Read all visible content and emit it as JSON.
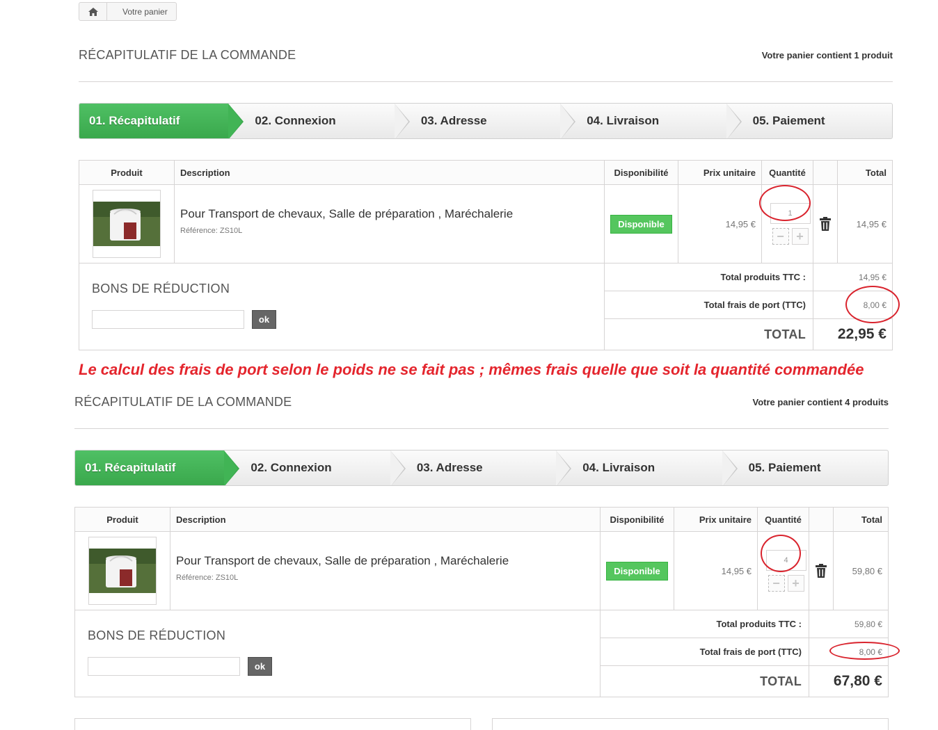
{
  "breadcrumb": {
    "home_icon": "home-icon",
    "current": "Votre panier"
  },
  "note": "Le calcul des frais de port selon le poids ne se fait pas ; mêmes frais quelle que soit la quantité commandée",
  "colors": {
    "accent_green": "#41b455",
    "available_green": "#55c65e",
    "annotation_red": "#e4252d"
  },
  "carts": [
    {
      "title": "RÉCAPITULATIF DE LA COMMANDE",
      "count": "Votre panier contient 1 produit",
      "steps": [
        "01. Récapitulatif",
        "02. Connexion",
        "03. Adresse",
        "04. Livraison",
        "05. Paiement"
      ],
      "headers": {
        "product": "Produit",
        "description": "Description",
        "availability": "Disponibilité",
        "unit_price": "Prix unitaire",
        "quantity": "Quantité",
        "total": "Total"
      },
      "item": {
        "name": "Pour Transport de chevaux, Salle de préparation , Maréchalerie",
        "reference": "Référence: ZS10L",
        "availability": "Disponible",
        "unit_price": "14,95 €",
        "quantity": "1",
        "total": "14,95 €"
      },
      "vouchers_title": "BONS DE RÉDUCTION",
      "vouchers_button": "ok",
      "totals": {
        "products_label": "Total produits TTC :",
        "products_value": "14,95 €",
        "shipping_label": "Total frais de port (TTC)",
        "shipping_value": "8,00 €",
        "total_label": "TOTAL",
        "total_value": "22,95 €"
      }
    },
    {
      "title": "RÉCAPITULATIF DE LA COMMANDE",
      "count": "Votre panier contient 4 produits",
      "steps": [
        "01. Récapitulatif",
        "02. Connexion",
        "03. Adresse",
        "04. Livraison",
        "05. Paiement"
      ],
      "headers": {
        "product": "Produit",
        "description": "Description",
        "availability": "Disponibilité",
        "unit_price": "Prix unitaire",
        "quantity": "Quantité",
        "total": "Total"
      },
      "item": {
        "name": "Pour Transport de chevaux, Salle de préparation , Maréchalerie",
        "reference": "Référence: ZS10L",
        "availability": "Disponible",
        "unit_price": "14,95 €",
        "quantity": "4",
        "total": "59,80 €"
      },
      "vouchers_title": "BONS DE RÉDUCTION",
      "vouchers_button": "ok",
      "totals": {
        "products_label": "Total produits TTC :",
        "products_value": "59,80 €",
        "shipping_label": "Total frais de port (TTC)",
        "shipping_value": "8,00 €",
        "total_label": "TOTAL",
        "total_value": "67,80 €"
      }
    }
  ]
}
